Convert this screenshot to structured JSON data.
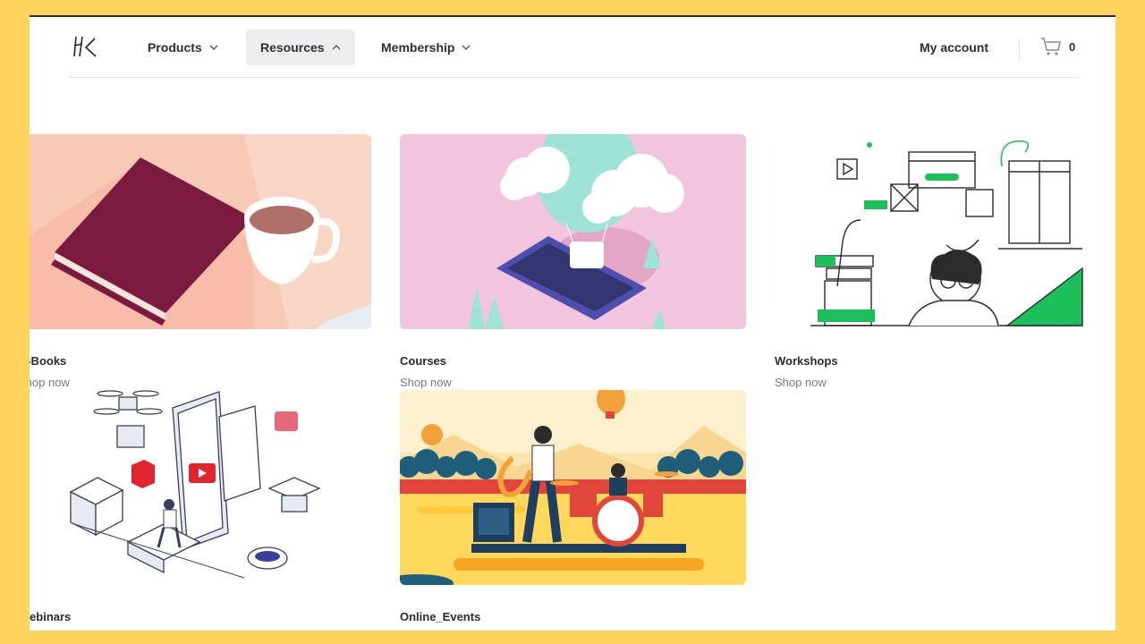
{
  "nav": {
    "products": "Products",
    "resources": "Resources",
    "membership": "Membership",
    "account": "My account",
    "cart_count": "0"
  },
  "cards": [
    {
      "title": "e-Books",
      "cta": "Shop now"
    },
    {
      "title": "Courses",
      "cta": "Shop now"
    },
    {
      "title": "Workshops",
      "cta": "Shop now"
    },
    {
      "title": "Webinars"
    },
    {
      "title": "Online_Events"
    }
  ],
  "colors": {
    "frame": "#FFD35C",
    "ebook_bg": "#F8C9B5",
    "courses_bg": "#F2C4DE",
    "accent_green": "#1DBF5B",
    "events_sun": "#FFC93C"
  }
}
